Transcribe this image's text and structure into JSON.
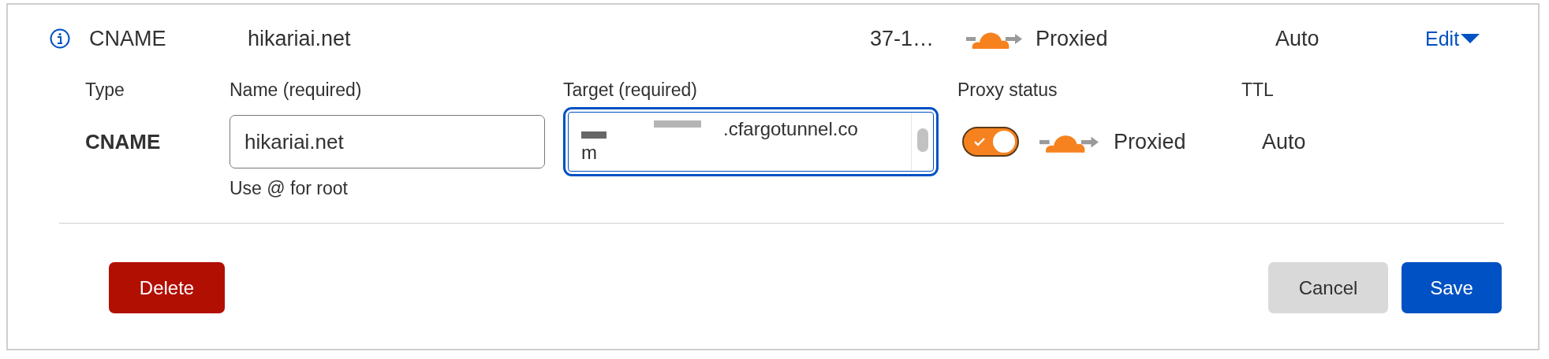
{
  "record": {
    "type": "CNAME",
    "name": "hikariai.net",
    "content": "37-1…",
    "proxy_status": "Proxied",
    "proxied": true,
    "ttl": "Auto",
    "edit_link": "Edit",
    "expanded": true
  },
  "editor": {
    "type_label": "Type",
    "type_value": "CNAME",
    "name_field": {
      "label": "Name (required)",
      "value": "hikariai.net",
      "hint": "Use @ for root"
    },
    "target_field": {
      "label": "Target (required)",
      "value": ".cfargotunnel.co\nm",
      "focused": true
    },
    "proxy": {
      "label": "Proxy status",
      "on": true,
      "text": "Proxied"
    },
    "ttl": {
      "label": "TTL",
      "value": "Auto"
    }
  },
  "buttons": [
    {
      "label": "Delete",
      "kind": "danger"
    },
    {
      "label": "Cancel",
      "kind": "secondary"
    },
    {
      "label": "Save",
      "kind": "primary"
    }
  ]
}
